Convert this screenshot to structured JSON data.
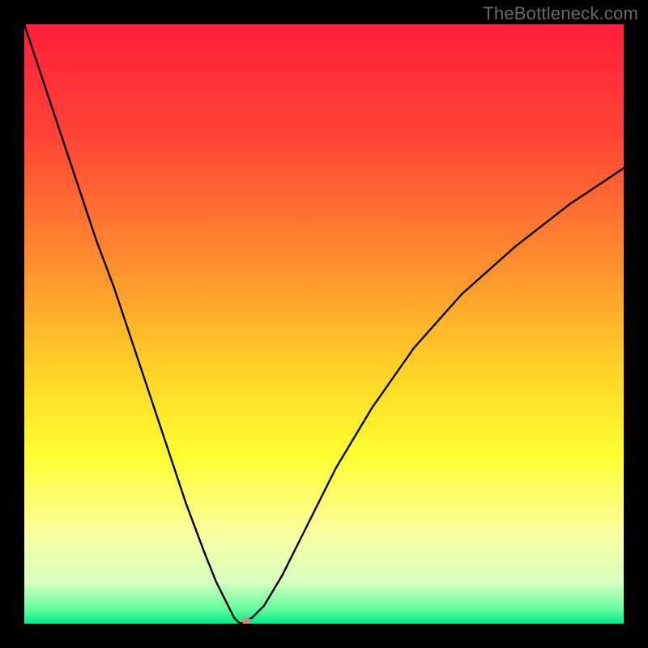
{
  "watermark": "TheBottleneck.com",
  "chart_data": {
    "type": "line",
    "title": "",
    "xlabel": "",
    "ylabel": "",
    "xlim": [
      0,
      100
    ],
    "ylim": [
      0,
      100
    ],
    "background_gradient": {
      "stops": [
        {
          "offset": 0.0,
          "color": "#ff1f3a"
        },
        {
          "offset": 0.18,
          "color": "#ff4236"
        },
        {
          "offset": 0.4,
          "color": "#ff8f2e"
        },
        {
          "offset": 0.58,
          "color": "#ffd327"
        },
        {
          "offset": 0.72,
          "color": "#ffff30"
        },
        {
          "offset": 0.85,
          "color": "#faffa0"
        },
        {
          "offset": 0.93,
          "color": "#d8ffc0"
        },
        {
          "offset": 0.975,
          "color": "#64ffa0"
        },
        {
          "offset": 1.0,
          "color": "#00e884"
        }
      ]
    },
    "series": [
      {
        "name": "bottleneck-curve",
        "color": "#000000",
        "x": [
          0,
          3,
          6,
          9,
          12,
          15,
          18,
          21,
          24,
          27,
          30,
          32,
          34,
          35,
          36,
          37,
          38,
          40,
          43,
          47,
          52,
          58,
          65,
          73,
          82,
          91,
          100
        ],
        "y": [
          100,
          91,
          82,
          73,
          64,
          56,
          47,
          38,
          29,
          20,
          12,
          7,
          3,
          1,
          0,
          0.5,
          1,
          3,
          8,
          16,
          26,
          36,
          46,
          55,
          63,
          70,
          76
        ]
      }
    ],
    "marker": {
      "x": 37,
      "y": 0.5,
      "rx": 6,
      "ry": 4,
      "color": "#c98a7a"
    }
  }
}
